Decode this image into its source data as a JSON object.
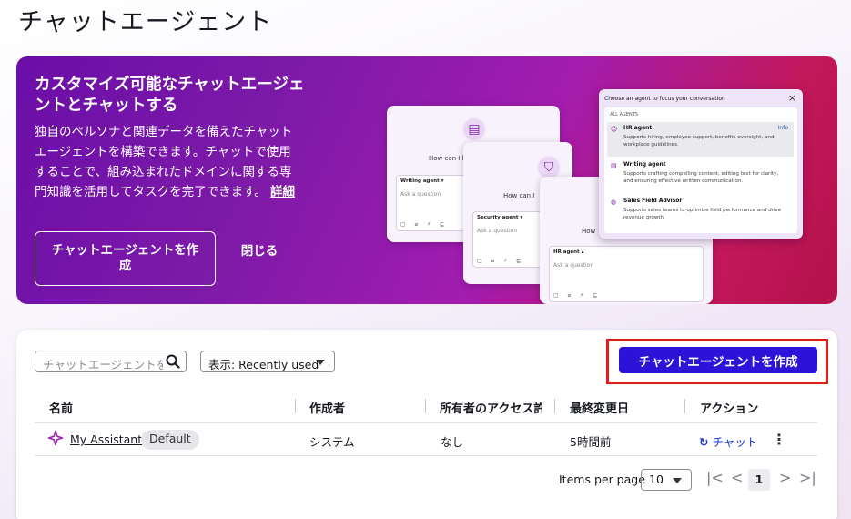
{
  "page": {
    "title": "チャットエージェント"
  },
  "banner": {
    "title": "カスタマイズ可能なチャットエージェントとチャットする",
    "description": "独自のペルソナと関連データを備えたチャットエージェントを構築できます。チャットで使用することで、組み込まれたドメインに関する専門知識を活用してタスクを完了できます。",
    "details_link": "詳細",
    "create_button": "チャットエージェントを作成",
    "close_button": "閉じる",
    "illustration": {
      "card1": {
        "greeting": "How can I help you today?",
        "agent": "Writing agent ▾",
        "ask": "Ask a question",
        "tools": "▢ ⌀ ⚡ ⊑"
      },
      "card2": {
        "greeting": "How can I",
        "agent": "Security agent ▾",
        "ask": "Ask a question",
        "tools": "▢ ⌀ ⚡ ⊑"
      },
      "card3": {
        "greeting": "How",
        "agent": "HR agent ▴",
        "ask": "Ask a question",
        "tools": "▢ ⌀ ⚡ ⊑"
      },
      "chooser": {
        "header": "Choose an agent to focus your conversation",
        "section": "ALL AGENTS",
        "options": [
          {
            "name": "HR agent",
            "desc": "Supports hiring, employee support, benefits oversight, and workplace guidelines.",
            "info": "Info",
            "selected": true
          },
          {
            "name": "Writing agent",
            "desc": "Supports crafting compelling content, editing text for clarity, and ensuring effective written communication."
          },
          {
            "name": "Sales Field Advisor",
            "desc": "Supports sales teams to optimize field performance and drive revenue growth."
          }
        ]
      }
    }
  },
  "toolbar": {
    "search_placeholder": "チャットエージェントを検索",
    "view_select": "表示: Recently used",
    "create_button": "チャットエージェントを作成"
  },
  "table": {
    "columns": [
      "名前",
      "作成者",
      "所有者のアクセス許可",
      "最終変更日",
      "アクション"
    ],
    "rows": [
      {
        "name": "My Assistant",
        "badge": "Default",
        "creator": "システム",
        "owner_access": "なし",
        "modified": "5時間前",
        "action": "チャット"
      }
    ]
  },
  "pagination": {
    "items_per_page_label": "Items per page",
    "items_per_page": "10",
    "current_page": "1"
  },
  "colors": {
    "primary": "#2b14d8",
    "highlight": "#e01c1c",
    "banner": "#7c1aa8"
  }
}
